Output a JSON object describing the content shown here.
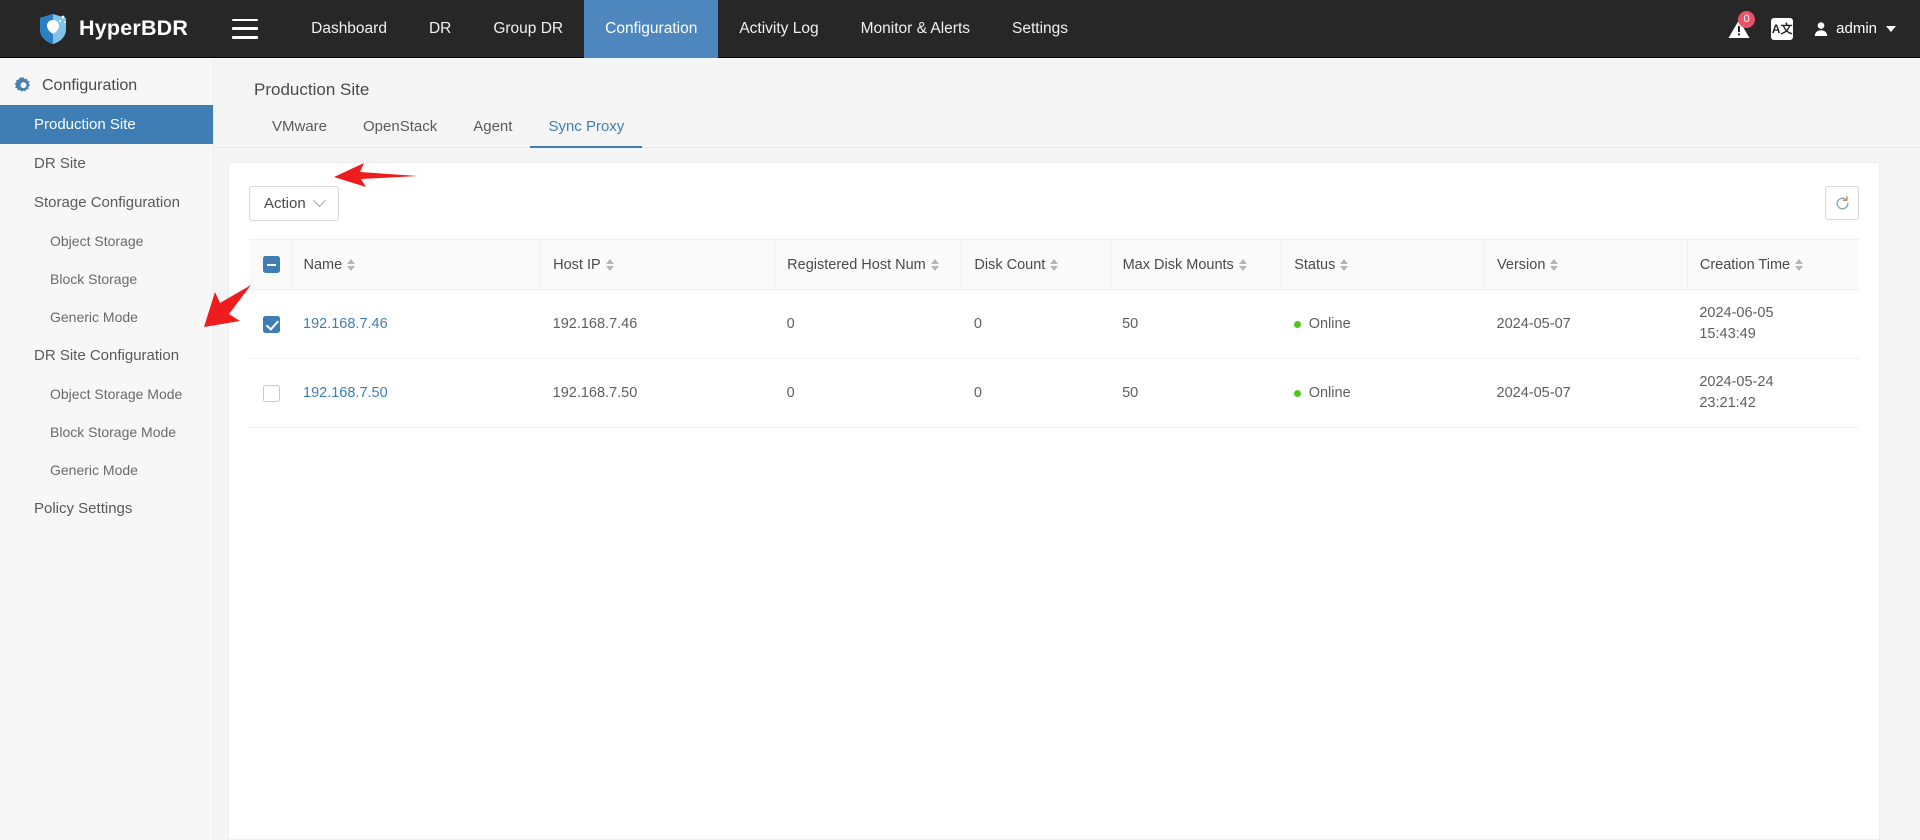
{
  "app": {
    "brand": "HyperBDR",
    "brand_logo_icon": "shield-logo-icon",
    "menu_icon": "hamburger-menu-icon"
  },
  "topnav": {
    "items": [
      {
        "label": "Dashboard",
        "active": false
      },
      {
        "label": "DR",
        "active": false
      },
      {
        "label": "Group DR",
        "active": false
      },
      {
        "label": "Configuration",
        "active": true
      },
      {
        "label": "Activity Log",
        "active": false
      },
      {
        "label": "Monitor & Alerts",
        "active": false
      },
      {
        "label": "Settings",
        "active": false
      }
    ],
    "alert_icon": "warning-alert-icon",
    "alert_count": "0",
    "language_icon": "language-translate-icon",
    "language_label": "A文",
    "user_icon": "user-avatar-icon",
    "user_name": "admin"
  },
  "sidebar": {
    "header_icon": "gear-configuration-icon",
    "header": "Configuration",
    "items": [
      {
        "label": "Production Site",
        "level": 1,
        "active": true
      },
      {
        "label": "DR Site",
        "level": 1,
        "active": false
      },
      {
        "label": "Storage Configuration",
        "level": 1,
        "active": false
      },
      {
        "label": "Object Storage",
        "level": 2,
        "active": false
      },
      {
        "label": "Block Storage",
        "level": 2,
        "active": false
      },
      {
        "label": "Generic Mode",
        "level": 2,
        "active": false
      },
      {
        "label": "DR Site Configuration",
        "level": 1,
        "active": false
      },
      {
        "label": "Object Storage Mode",
        "level": 2,
        "active": false
      },
      {
        "label": "Block Storage Mode",
        "level": 2,
        "active": false
      },
      {
        "label": "Generic Mode",
        "level": 2,
        "active": false
      },
      {
        "label": "Policy Settings",
        "level": 1,
        "active": false
      }
    ]
  },
  "main": {
    "page_title": "Production Site",
    "tabs": [
      {
        "label": "VMware",
        "active": false
      },
      {
        "label": "OpenStack",
        "active": false
      },
      {
        "label": "Agent",
        "active": false
      },
      {
        "label": "Sync Proxy",
        "active": true
      }
    ],
    "toolbar": {
      "action_label": "Action",
      "action_chevron_icon": "chevron-down-icon",
      "refresh_icon": "refresh-reload-icon"
    },
    "table": {
      "select_all_state": "indeterminate",
      "columns": [
        {
          "label": "Name",
          "sortable": true
        },
        {
          "label": "Host IP",
          "sortable": true
        },
        {
          "label": "Registered Host Num",
          "sortable": true
        },
        {
          "label": "Disk Count",
          "sortable": true
        },
        {
          "label": "Max Disk Mounts",
          "sortable": true
        },
        {
          "label": "Status",
          "sortable": true
        },
        {
          "label": "Version",
          "sortable": true
        },
        {
          "label": "Creation Time",
          "sortable": true
        }
      ],
      "rows": [
        {
          "selected": true,
          "name": "192.168.7.46",
          "host_ip": "192.168.7.46",
          "registered_host_num": "0",
          "disk_count": "0",
          "max_disk_mounts": "50",
          "status": "Online",
          "status_color": "#52c41a",
          "version": "2024-05-07",
          "creation_date": "2024-06-05",
          "creation_time": "15:43:49"
        },
        {
          "selected": false,
          "name": "192.168.7.50",
          "host_ip": "192.168.7.50",
          "registered_host_num": "0",
          "disk_count": "0",
          "max_disk_mounts": "50",
          "status": "Online",
          "status_color": "#52c41a",
          "version": "2024-05-07",
          "creation_date": "2024-05-24",
          "creation_time": "23:21:42"
        }
      ]
    }
  },
  "annotations": [
    {
      "name": "arrow-pointing-to-action-button",
      "color": "#ee1c1c"
    },
    {
      "name": "arrow-pointing-to-row-checkbox",
      "color": "#ee1c1c"
    }
  ],
  "colors": {
    "accent": "#3e7eb5",
    "nav_active": "#4d87bd",
    "topbar_bg": "#272727",
    "status_online": "#52c41a",
    "badge": "#e8536a",
    "annotation": "#ee1c1c"
  }
}
